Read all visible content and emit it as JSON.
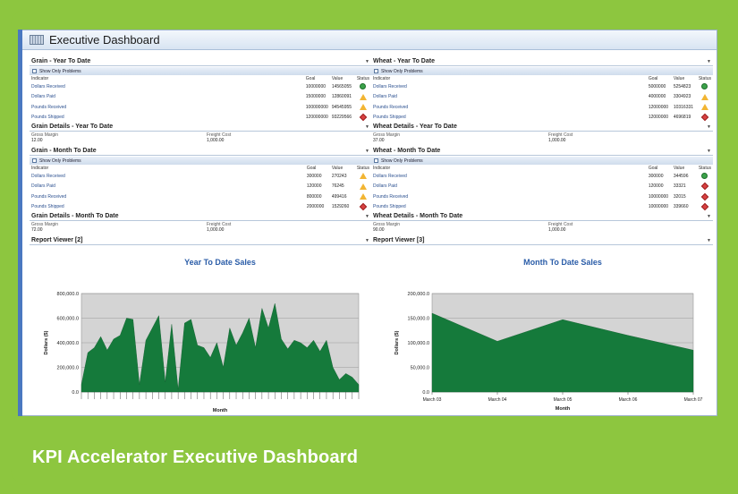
{
  "window": {
    "title": "Executive Dashboard"
  },
  "caption": "KPI Accelerator Executive Dashboard",
  "show_problems_label": "Show Only Problems",
  "columns": {
    "indicator": "Indicator",
    "goal": "Goal",
    "value": "Value",
    "status": "Status"
  },
  "grain_ytd": {
    "title": "Grain - Year To Date",
    "rows": [
      {
        "label": "Dollars Received",
        "goal": "10000000",
        "value": "14565055",
        "status": "ok"
      },
      {
        "label": "Dollars Paid",
        "goal": "15000000",
        "value": "12860091",
        "status": "warn"
      },
      {
        "label": "Pounds Received",
        "goal": "100000000",
        "value": "94545955",
        "status": "warn"
      },
      {
        "label": "Pounds Shipped",
        "goal": "120000000",
        "value": "93229566",
        "status": "bad"
      }
    ]
  },
  "wheat_ytd": {
    "title": "Wheat - Year To Date",
    "rows": [
      {
        "label": "Dollars Received",
        "goal": "5000000",
        "value": "5254823",
        "status": "ok"
      },
      {
        "label": "Dollars Paid",
        "goal": "4000000",
        "value": "3304923",
        "status": "warn"
      },
      {
        "label": "Pounds Received",
        "goal": "12000000",
        "value": "10316331",
        "status": "warn"
      },
      {
        "label": "Pounds Shipped",
        "goal": "12000000",
        "value": "4696819",
        "status": "bad"
      }
    ]
  },
  "grain_details_ytd": {
    "title": "Grain Details - Year To Date",
    "gm_label": "Gross Margin",
    "gm_value": "12.00",
    "fc_label": "Freight Cost",
    "fc_value": "1,000.00"
  },
  "wheat_details_ytd": {
    "title": "Wheat Details - Year To Date",
    "gm_label": "Gross Margin",
    "gm_value": "37.00",
    "fc_label": "Freight Cost",
    "fc_value": "1,000.00"
  },
  "grain_mtd": {
    "title": "Grain - Month To Date",
    "rows": [
      {
        "label": "Dollars Received",
        "goal": "300000",
        "value": "270243",
        "status": "warn"
      },
      {
        "label": "Dollars Paid",
        "goal": "120000",
        "value": "76245",
        "status": "warn"
      },
      {
        "label": "Pounds Received",
        "goal": "800000",
        "value": "499416",
        "status": "warn"
      },
      {
        "label": "Pounds Shipped",
        "goal": "2000000",
        "value": "1529260",
        "status": "bad"
      }
    ]
  },
  "wheat_mtd": {
    "title": "Wheat - Month To Date",
    "rows": [
      {
        "label": "Dollars Received",
        "goal": "300000",
        "value": "344596",
        "status": "ok"
      },
      {
        "label": "Dollars Paid",
        "goal": "120000",
        "value": "33321",
        "status": "bad"
      },
      {
        "label": "Pounds Received",
        "goal": "10000000",
        "value": "32015",
        "status": "bad"
      },
      {
        "label": "Pounds Shipped",
        "goal": "10000000",
        "value": "339660",
        "status": "bad"
      }
    ]
  },
  "grain_details_mtd": {
    "title": "Grain Details - Month To Date",
    "gm_label": "Gross Margin",
    "gm_value": "72.00",
    "fc_label": "Freight Cost",
    "fc_value": "1,000.00"
  },
  "wheat_details_mtd": {
    "title": "Wheat Details - Month To Date",
    "gm_label": "Gross Margin",
    "gm_value": "90.00",
    "fc_label": "Freight Cost",
    "fc_value": "1,000.00"
  },
  "report_left": {
    "title": "Report Viewer [2]"
  },
  "report_right": {
    "title": "Report Viewer [3]"
  },
  "chart_data": [
    {
      "type": "area",
      "title": "Year To Date Sales",
      "xlabel": "Month",
      "ylabel": "Dollars ($)",
      "ylim": [
        0,
        800000
      ],
      "yticks": [
        "0.0",
        "200,000.0",
        "400,000.0",
        "600,000.0",
        "800,000.0"
      ],
      "values": [
        60000,
        320000,
        360000,
        450000,
        340000,
        430000,
        460000,
        600000,
        590000,
        60000,
        420000,
        520000,
        620000,
        80000,
        550000,
        20000,
        560000,
        590000,
        380000,
        360000,
        280000,
        400000,
        200000,
        520000,
        380000,
        480000,
        600000,
        360000,
        680000,
        520000,
        720000,
        430000,
        350000,
        420000,
        400000,
        360000,
        420000,
        330000,
        420000,
        200000,
        100000,
        150000,
        120000,
        60000
      ],
      "grid": true
    },
    {
      "type": "area",
      "title": "Month To Date Sales",
      "xlabel": "Month",
      "ylabel": "Dollars ($)",
      "ylim": [
        0,
        200000
      ],
      "yticks": [
        "0.0",
        "50,000.0",
        "100,000.0",
        "150,000.0",
        "200,000.0"
      ],
      "categories": [
        "March 03",
        "March 04",
        "March 05",
        "March 06",
        "March 07"
      ],
      "values": [
        160000,
        103000,
        147000,
        115000,
        85000
      ],
      "grid": true
    }
  ],
  "colors": {
    "area": "#157a3b",
    "plot_bg": "#d4d4d4",
    "chart_title": "#2b5da8",
    "frame": "#8dc63f"
  }
}
